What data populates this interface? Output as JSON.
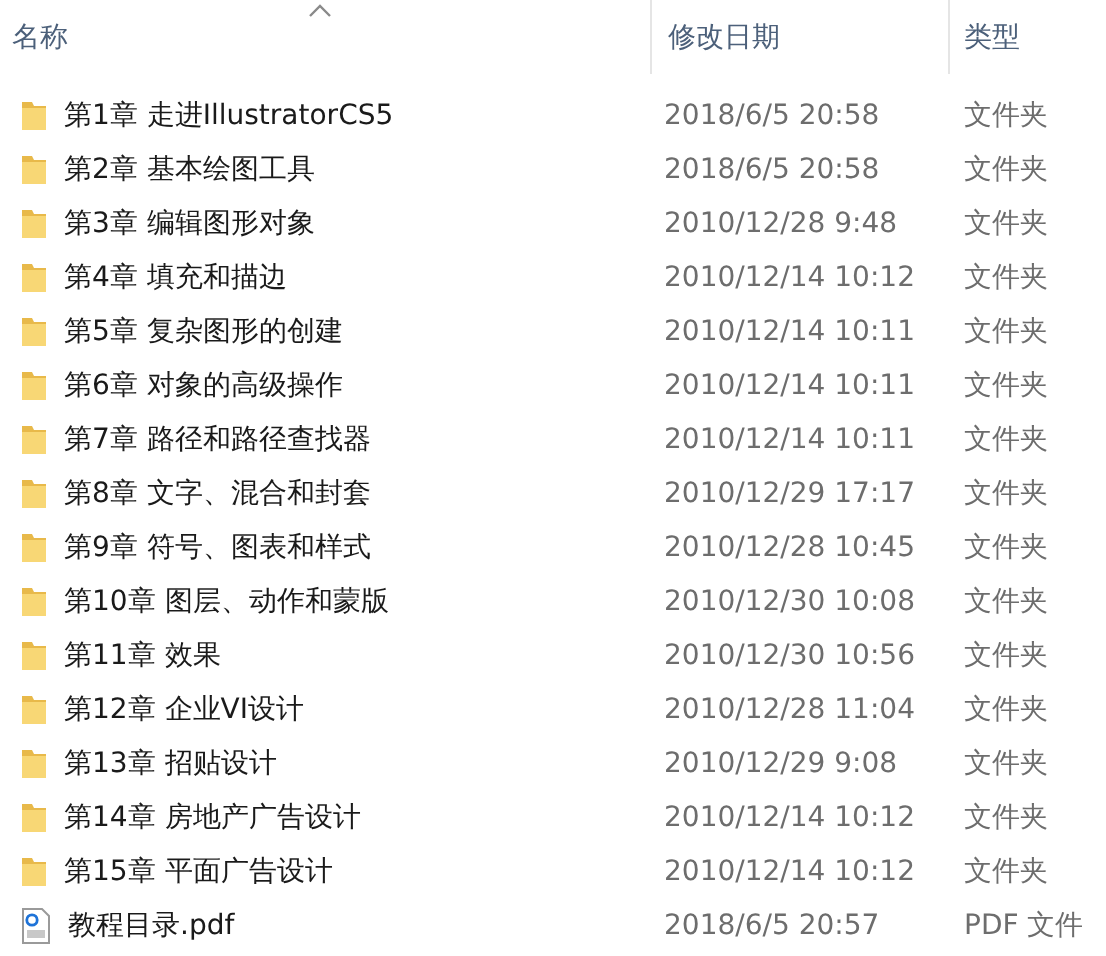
{
  "columns": [
    {
      "label": "名称",
      "sorted": true
    },
    {
      "label": "修改日期",
      "sorted": false
    },
    {
      "label": "类型",
      "sorted": false
    }
  ],
  "rows": [
    {
      "kind": "folder",
      "name": "第1章 走进IllustratorCS5",
      "date": "2018/6/5 20:58",
      "type": "文件夹"
    },
    {
      "kind": "folder",
      "name": "第2章 基本绘图工具",
      "date": "2018/6/5 20:58",
      "type": "文件夹"
    },
    {
      "kind": "folder",
      "name": "第3章 编辑图形对象",
      "date": "2010/12/28 9:48",
      "type": "文件夹"
    },
    {
      "kind": "folder",
      "name": "第4章 填充和描边",
      "date": "2010/12/14 10:12",
      "type": "文件夹"
    },
    {
      "kind": "folder",
      "name": "第5章 复杂图形的创建",
      "date": "2010/12/14 10:11",
      "type": "文件夹"
    },
    {
      "kind": "folder",
      "name": "第6章 对象的高级操作",
      "date": "2010/12/14 10:11",
      "type": "文件夹"
    },
    {
      "kind": "folder",
      "name": "第7章 路径和路径查找器",
      "date": "2010/12/14 10:11",
      "type": "文件夹"
    },
    {
      "kind": "folder",
      "name": "第8章 文字、混合和封套",
      "date": "2010/12/29 17:17",
      "type": "文件夹"
    },
    {
      "kind": "folder",
      "name": "第9章 符号、图表和样式",
      "date": "2010/12/28 10:45",
      "type": "文件夹"
    },
    {
      "kind": "folder",
      "name": "第10章 图层、动作和蒙版",
      "date": "2010/12/30 10:08",
      "type": "文件夹"
    },
    {
      "kind": "folder",
      "name": "第11章 效果",
      "date": "2010/12/30 10:56",
      "type": "文件夹"
    },
    {
      "kind": "folder",
      "name": "第12章 企业VI设计",
      "date": "2010/12/28 11:04",
      "type": "文件夹"
    },
    {
      "kind": "folder",
      "name": "第13章 招贴设计",
      "date": "2010/12/29 9:08",
      "type": "文件夹"
    },
    {
      "kind": "folder",
      "name": "第14章 房地产广告设计",
      "date": "2010/12/14 10:12",
      "type": "文件夹"
    },
    {
      "kind": "folder",
      "name": "第15章 平面广告设计",
      "date": "2010/12/14 10:12",
      "type": "文件夹"
    },
    {
      "kind": "pdf",
      "name": "教程目录.pdf",
      "date": "2018/6/5 20:57",
      "type": "PDF 文件"
    }
  ]
}
